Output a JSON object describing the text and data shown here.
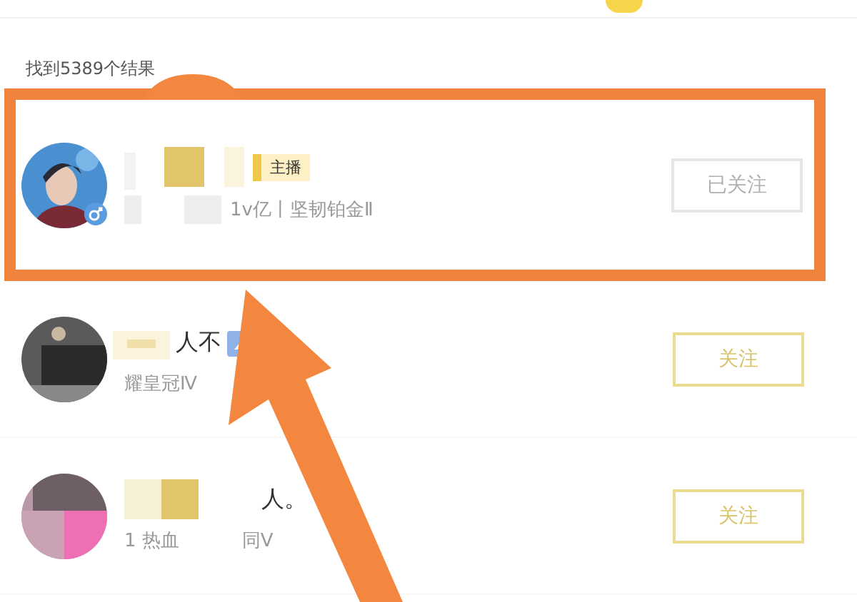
{
  "results_count": "找到5389个结果",
  "results": [
    {
      "highlighted": true,
      "badge": "主播",
      "gender_badge": true,
      "subtitle": [
        "1v亿丨坚韧铂金Ⅱ"
      ],
      "follow_label": "已关注",
      "followed": true
    },
    {
      "highlighted": false,
      "name": "人不",
      "subtitle": [
        "耀皇冠Ⅳ"
      ],
      "follow_label": "关注",
      "followed": false
    },
    {
      "highlighted": false,
      "name": "人。",
      "subtitle": [
        "1 热血",
        "同Ⅴ"
      ],
      "follow_label": "关注",
      "followed": false
    }
  ]
}
